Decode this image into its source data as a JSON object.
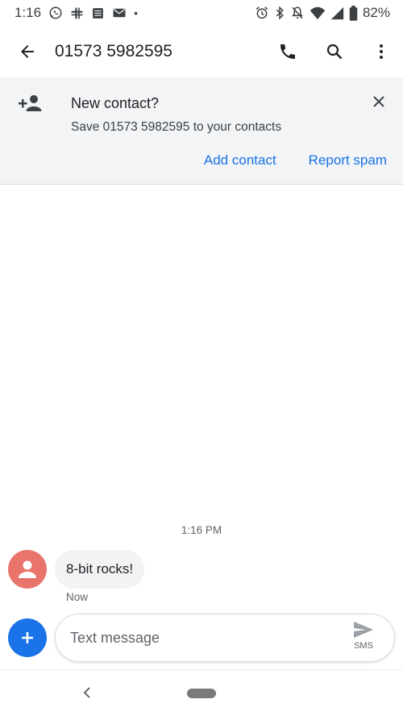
{
  "status_bar": {
    "time": "1:16",
    "notif_icons": [
      "whatsapp-icon",
      "slack-icon",
      "calendar-icon",
      "mail-icon"
    ],
    "dot": "•",
    "battery": "82%"
  },
  "header": {
    "title": "01573 5982595",
    "actions": [
      "call-icon",
      "search-icon",
      "more-vert-icon"
    ]
  },
  "banner": {
    "title": "New contact?",
    "subtitle": "Save 01573 5982595 to your contacts",
    "add_label": "Add contact",
    "spam_label": "Report spam"
  },
  "conversation": {
    "timestamp": "1:16 PM",
    "messages": [
      {
        "text": "8-bit rocks!",
        "time": "Now"
      }
    ]
  },
  "compose": {
    "placeholder": "Text message",
    "send_mode": "SMS"
  },
  "colors": {
    "accent": "#1a73e8",
    "avatar": "#e8746c",
    "banner_bg": "#f2f4f6",
    "bubble_bg": "#f1f3f4"
  }
}
